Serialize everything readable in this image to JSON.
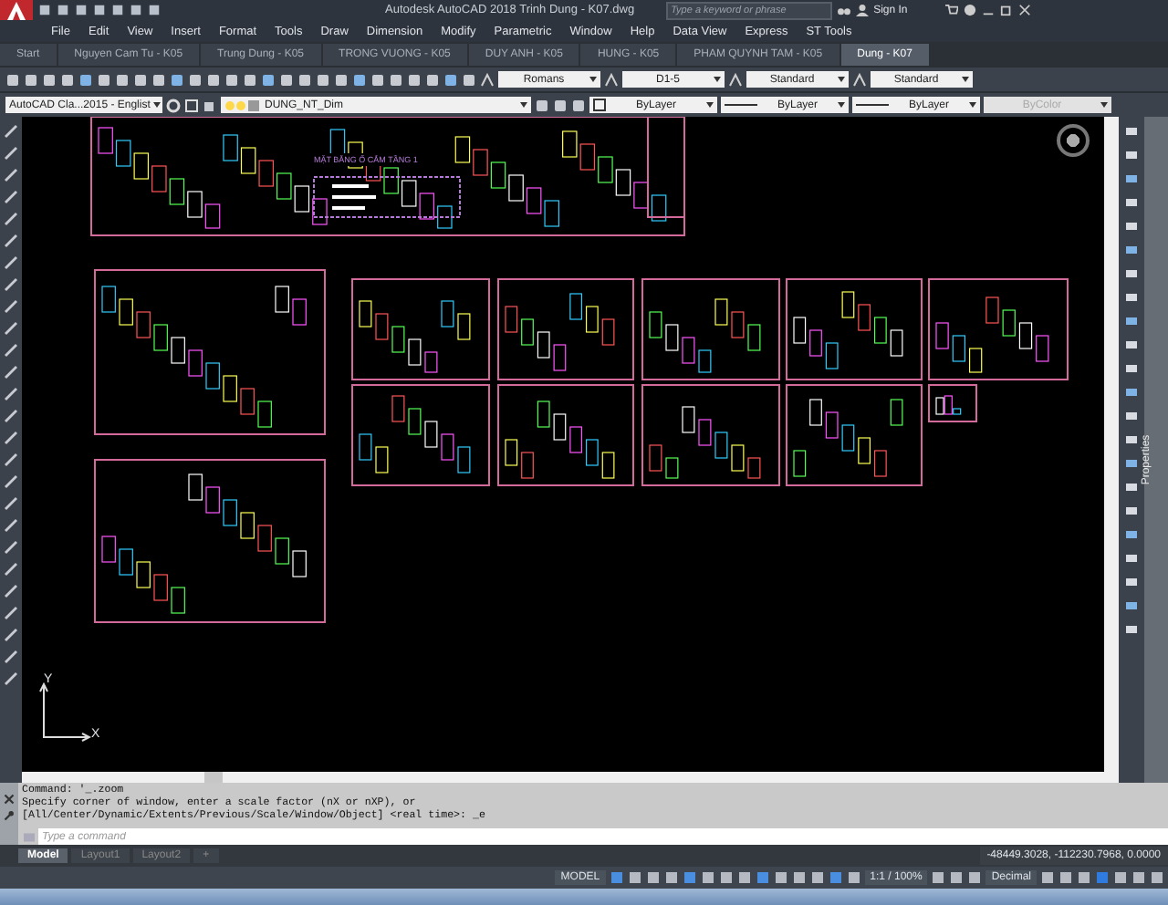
{
  "title_bar": {
    "title": "Autodesk AutoCAD 2018   Trinh Dung - K07.dwg",
    "search": {
      "placeholder": "Type a keyword or phrase"
    },
    "sign_in": "Sign In"
  },
  "menu": [
    "File",
    "Edit",
    "View",
    "Insert",
    "Format",
    "Tools",
    "Draw",
    "Dimension",
    "Modify",
    "Parametric",
    "Window",
    "Help",
    "Data View",
    "Express",
    "ST Tools"
  ],
  "tabs": [
    {
      "label": "Start",
      "selected": false
    },
    {
      "label": "Nguyen Cam Tu - K05",
      "selected": false
    },
    {
      "label": "Trung Dung - K05",
      "selected": false
    },
    {
      "label": "TRONG VUONG - K05",
      "selected": false
    },
    {
      "label": "DUY ANH - K05",
      "selected": false
    },
    {
      "label": "HUNG - K05",
      "selected": false
    },
    {
      "label": "PHAM QUYNH TAM - K05",
      "selected": false
    },
    {
      "label": "Dung - K07",
      "selected": true
    }
  ],
  "style_dropdowns": [
    {
      "value": "Romans"
    },
    {
      "value": "D1-5"
    },
    {
      "value": "Standard"
    },
    {
      "value": "Standard"
    }
  ],
  "workspace": {
    "value": "AutoCAD Cla...2015 - Englist"
  },
  "layer": {
    "value": "DUNG_NT_Dim"
  },
  "property_dropdowns": [
    {
      "value": "ByLayer",
      "kind": "color",
      "disabled": false
    },
    {
      "value": "ByLayer",
      "kind": "linetype",
      "disabled": false
    },
    {
      "value": "ByLayer",
      "kind": "lineweight",
      "disabled": false
    },
    {
      "value": "ByColor",
      "kind": "plotstyle",
      "disabled": true
    }
  ],
  "canvas": {
    "plan_title": "MẶT BẰNG Ổ CẮM TẦNG 1",
    "ucs": {
      "x_label": "X",
      "y_label": "Y"
    }
  },
  "command": {
    "history": [
      "Command: '_.zoom",
      "Specify corner of window, enter a scale factor (nX or nXP), or",
      "[All/Center/Dynamic/Extents/Previous/Scale/Window/Object] <real time>: _e"
    ],
    "placeholder": "Type a command"
  },
  "layout_tabs": [
    {
      "label": "Model",
      "selected": true
    },
    {
      "label": "Layout1",
      "selected": false
    },
    {
      "label": "Layout2",
      "selected": false
    },
    {
      "label": "+",
      "selected": false
    }
  ],
  "coordinates": "-48449.3028, -112230.7968, 0.0000",
  "status_bar": {
    "model": "MODEL",
    "scale": "1:1 / 100%",
    "units": "Decimal"
  },
  "properties_palette": {
    "label": "Properties"
  }
}
